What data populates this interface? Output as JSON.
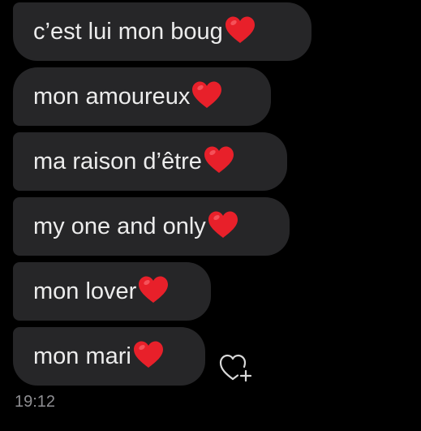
{
  "colors": {
    "background": "#000000",
    "bubble": "#262628",
    "text": "#ececec",
    "heart": "#e8202a",
    "timestamp": "#8e8e92"
  },
  "messages": [
    {
      "text": "c’est lui mon boug",
      "emoji": "red-heart"
    },
    {
      "text": "mon amoureux",
      "emoji": "red-heart"
    },
    {
      "text": "ma raison d’être",
      "emoji": "red-heart"
    },
    {
      "text": "my one and only",
      "emoji": "red-heart"
    },
    {
      "text": "mon lover",
      "emoji": "red-heart"
    },
    {
      "text": "mon mari",
      "emoji": "red-heart"
    }
  ],
  "reaction_button": {
    "icon": "heart-add-icon"
  },
  "timestamp": "19:12"
}
